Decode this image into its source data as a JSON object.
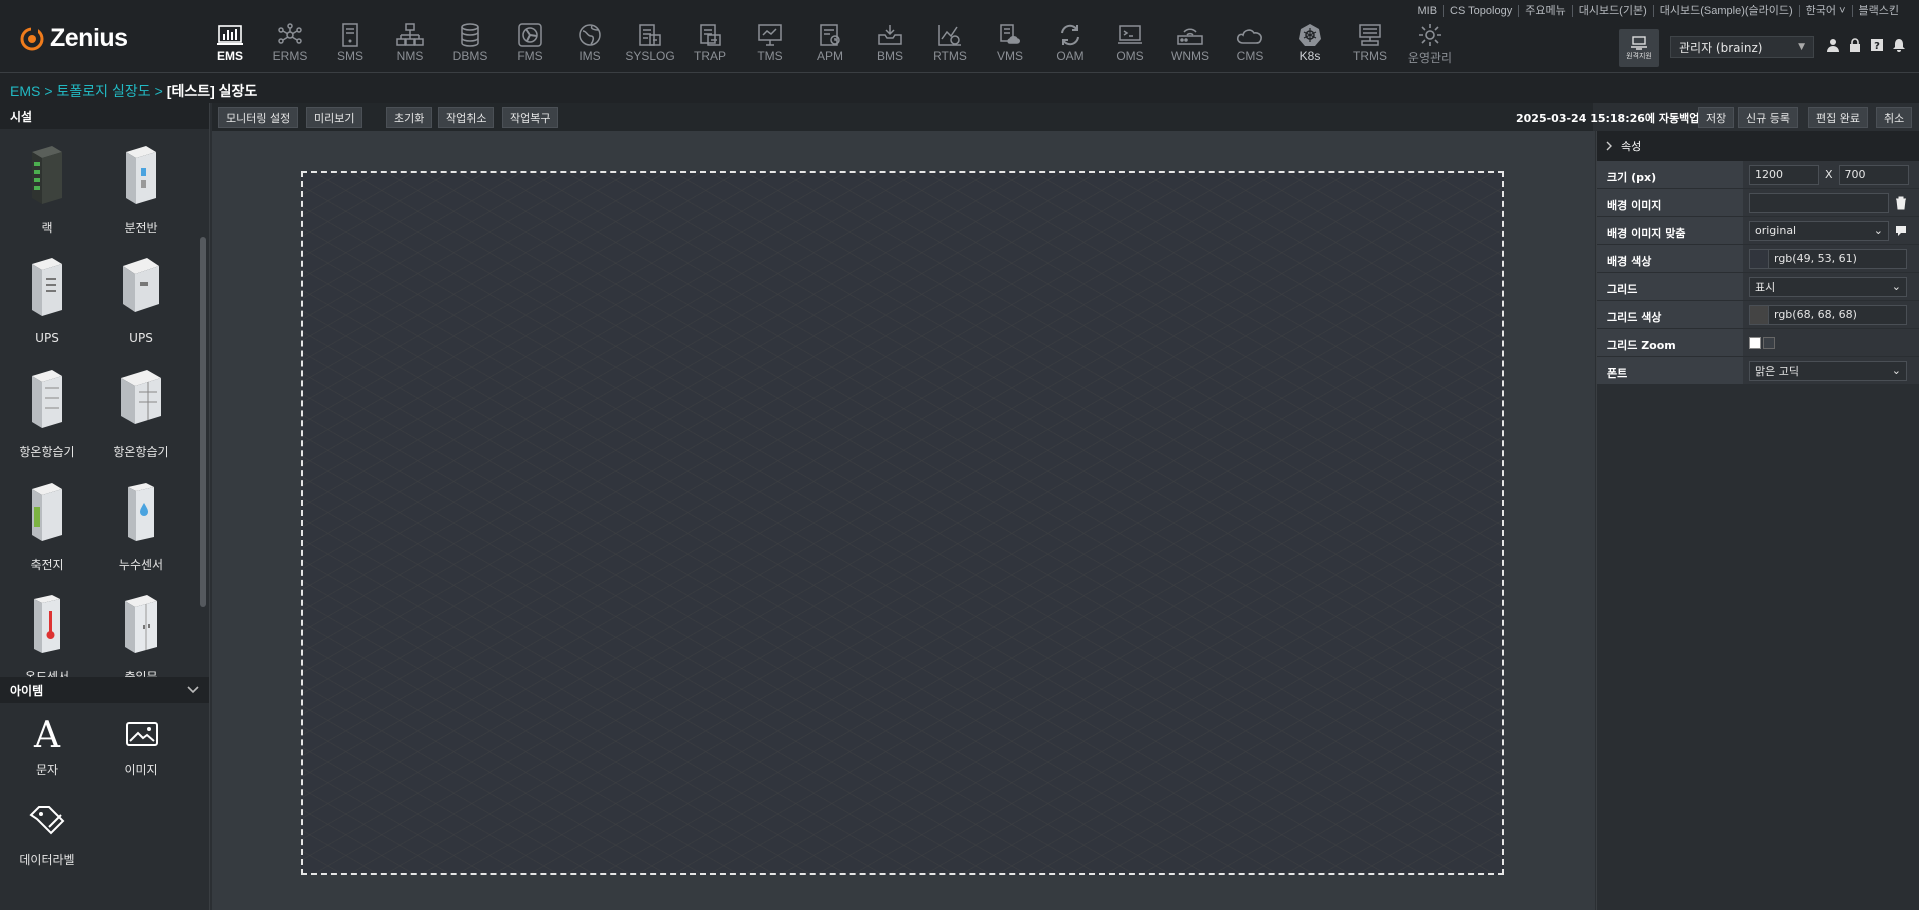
{
  "app": {
    "logo_text": "Zenius"
  },
  "menu": [
    {
      "label": "EMS",
      "icon": "bar-chart-icon",
      "active": true
    },
    {
      "label": "ERMS",
      "icon": "network-icon"
    },
    {
      "label": "SMS",
      "icon": "server-icon"
    },
    {
      "label": "NMS",
      "icon": "topology-icon"
    },
    {
      "label": "DBMS",
      "icon": "database-icon"
    },
    {
      "label": "FMS",
      "icon": "fan-icon"
    },
    {
      "label": "IMS",
      "icon": "globe-icon"
    },
    {
      "label": "SYSLOG",
      "icon": "log-icon"
    },
    {
      "label": "TRAP",
      "icon": "trap-icon"
    },
    {
      "label": "TMS",
      "icon": "monitor-icon"
    },
    {
      "label": "APM",
      "icon": "apm-icon"
    },
    {
      "label": "BMS",
      "icon": "inbox-icon"
    },
    {
      "label": "RTMS",
      "icon": "trend-icon"
    },
    {
      "label": "VMS",
      "icon": "vm-icon"
    },
    {
      "label": "OAM",
      "icon": "refresh-icon"
    },
    {
      "label": "OMS",
      "icon": "terminal-icon"
    },
    {
      "label": "WNMS",
      "icon": "router-icon"
    },
    {
      "label": "CMS",
      "icon": "cloud-icon"
    },
    {
      "label": "K8s",
      "icon": "kubernetes-icon"
    },
    {
      "label": "TRMS",
      "icon": "trms-icon"
    },
    {
      "label": "운영관리",
      "icon": "gear-icon"
    }
  ],
  "util_links": [
    "MIB",
    "CS Topology",
    "주요메뉴",
    "대시보드(기본)",
    "대시보드(Sample)(슬라이드)",
    "한국어 ˅",
    "블랙스킨"
  ],
  "remote": {
    "label": "원격지원"
  },
  "user": {
    "name": "관리자 (brainz)"
  },
  "breadcrumb": {
    "c1": "EMS",
    "c2": "토폴로지 실장도",
    "current": "[테스트] 실장도",
    "sep": ">"
  },
  "left": {
    "facility_title": "시설",
    "facilities": [
      "랙",
      "분전반",
      "UPS",
      "UPS",
      "항온항습기",
      "항온항습기",
      "축전지",
      "누수센서",
      "온도센서",
      "출입문"
    ],
    "item_title": "아이템",
    "items": [
      "문자",
      "이미지",
      "데이터라벨"
    ]
  },
  "toolbar": {
    "monitor_setting": "모니터링 설정",
    "preview": "미리보기",
    "reset": "초기화",
    "undo": "작업취소",
    "redo": "작업복구",
    "autosave": "2025-03-24 15:18:26에 자동백업됨",
    "save": "저장",
    "new": "신규 등록",
    "done": "편집 완료",
    "cancel": "취소"
  },
  "props": {
    "title": "속성",
    "size_label": "크기 (px)",
    "width": "1200",
    "x": "X",
    "height": "700",
    "bg_image_label": "배경 이미지",
    "bg_image_value": "",
    "bg_fit_label": "배경 이미지 맞춤",
    "bg_fit_value": "original",
    "bg_color_label": "배경 색상",
    "bg_color_value": "rgb(49, 53, 61)",
    "bg_color_hex": "#31353d",
    "grid_label": "그리드",
    "grid_value": "표시",
    "grid_color_label": "그리드 색상",
    "grid_color_value": "rgb(68, 68, 68)",
    "grid_color_hex": "#444444",
    "grid_zoom_label": "그리드 Zoom",
    "font_label": "폰트",
    "font_value": "맑은 고딕"
  }
}
